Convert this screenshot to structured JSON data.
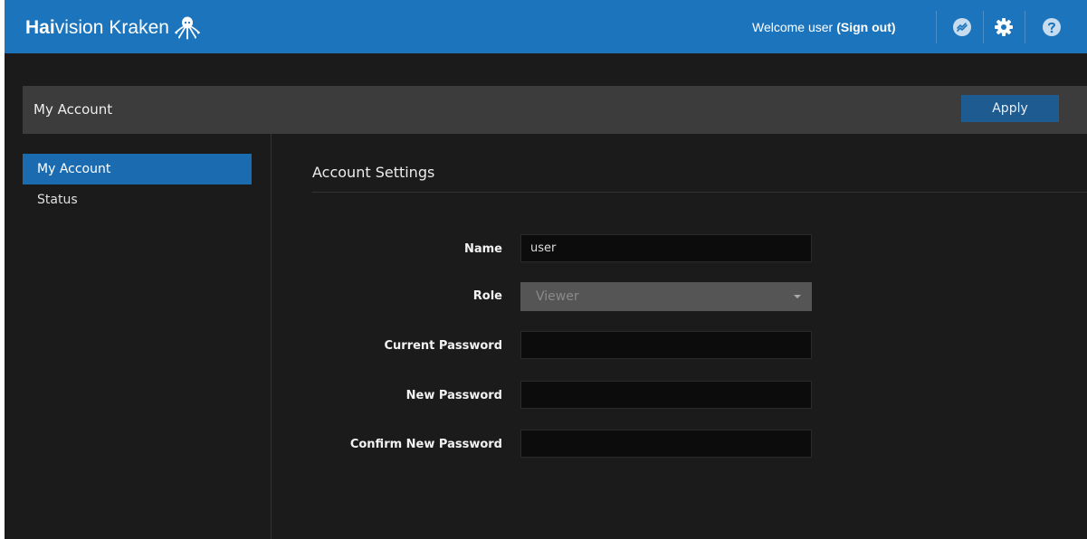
{
  "app": {
    "brand_bold": "Hai",
    "brand_rest": "vision",
    "brand_product": "Kraken",
    "logo_icon": "octopus-logo-icon"
  },
  "header": {
    "welcome_text": "Welcome user",
    "signout_open": "(",
    "signout_label": "Sign out",
    "signout_close": ")",
    "icons": [
      "sync-status-icon",
      "gear-icon",
      "help-icon"
    ]
  },
  "page": {
    "title": "My Account",
    "apply_label": "Apply"
  },
  "sidebar": {
    "items": [
      {
        "label": "My Account",
        "active": true
      },
      {
        "label": "Status",
        "active": false
      }
    ]
  },
  "form": {
    "section_title": "Account Settings",
    "name_label": "Name",
    "name_value": "user",
    "role_label": "Role",
    "role_value": "Viewer",
    "current_password_label": "Current Password",
    "current_password_value": "",
    "new_password_label": "New Password",
    "new_password_value": "",
    "confirm_password_label": "Confirm New Password",
    "confirm_password_value": ""
  },
  "colors": {
    "header_blue": "#1c75bc",
    "background": "#1b1b1b",
    "titlebar": "#3c3c3c",
    "active_item": "#1a6bb0",
    "apply_button": "#1d5b91",
    "input_bg": "#0c0c0c",
    "select_bg": "#555555"
  }
}
